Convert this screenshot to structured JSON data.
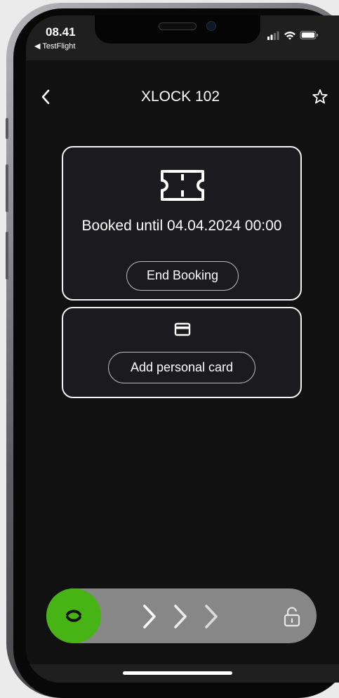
{
  "status_bar": {
    "time": "08.41",
    "back_app": "◀ TestFlight"
  },
  "header": {
    "title": "XLOCK 102",
    "back_icon": "chevron-left-icon",
    "favorite_icon": "star-outline-icon"
  },
  "booking_card": {
    "icon": "ticket-icon",
    "status_text": "Booked until 04.04.2024 00:00",
    "end_button_label": "End Booking"
  },
  "payment_card": {
    "icon": "credit-card-icon",
    "add_button_label": "Add personal card"
  },
  "unlock_slider": {
    "knob_icon": "handle-icon",
    "arrow_icon": "chevron-right-icon",
    "lock_icon": "unlocked-padlock-icon",
    "knob_color": "#46B414",
    "track_color": "#878787",
    "progress": 0
  },
  "colors": {
    "screen_background": "#111111",
    "card_background": "#1B1B1F",
    "card_border": "#F2F2F2",
    "text": "#FFFFFF",
    "accent_green": "#46B414"
  }
}
